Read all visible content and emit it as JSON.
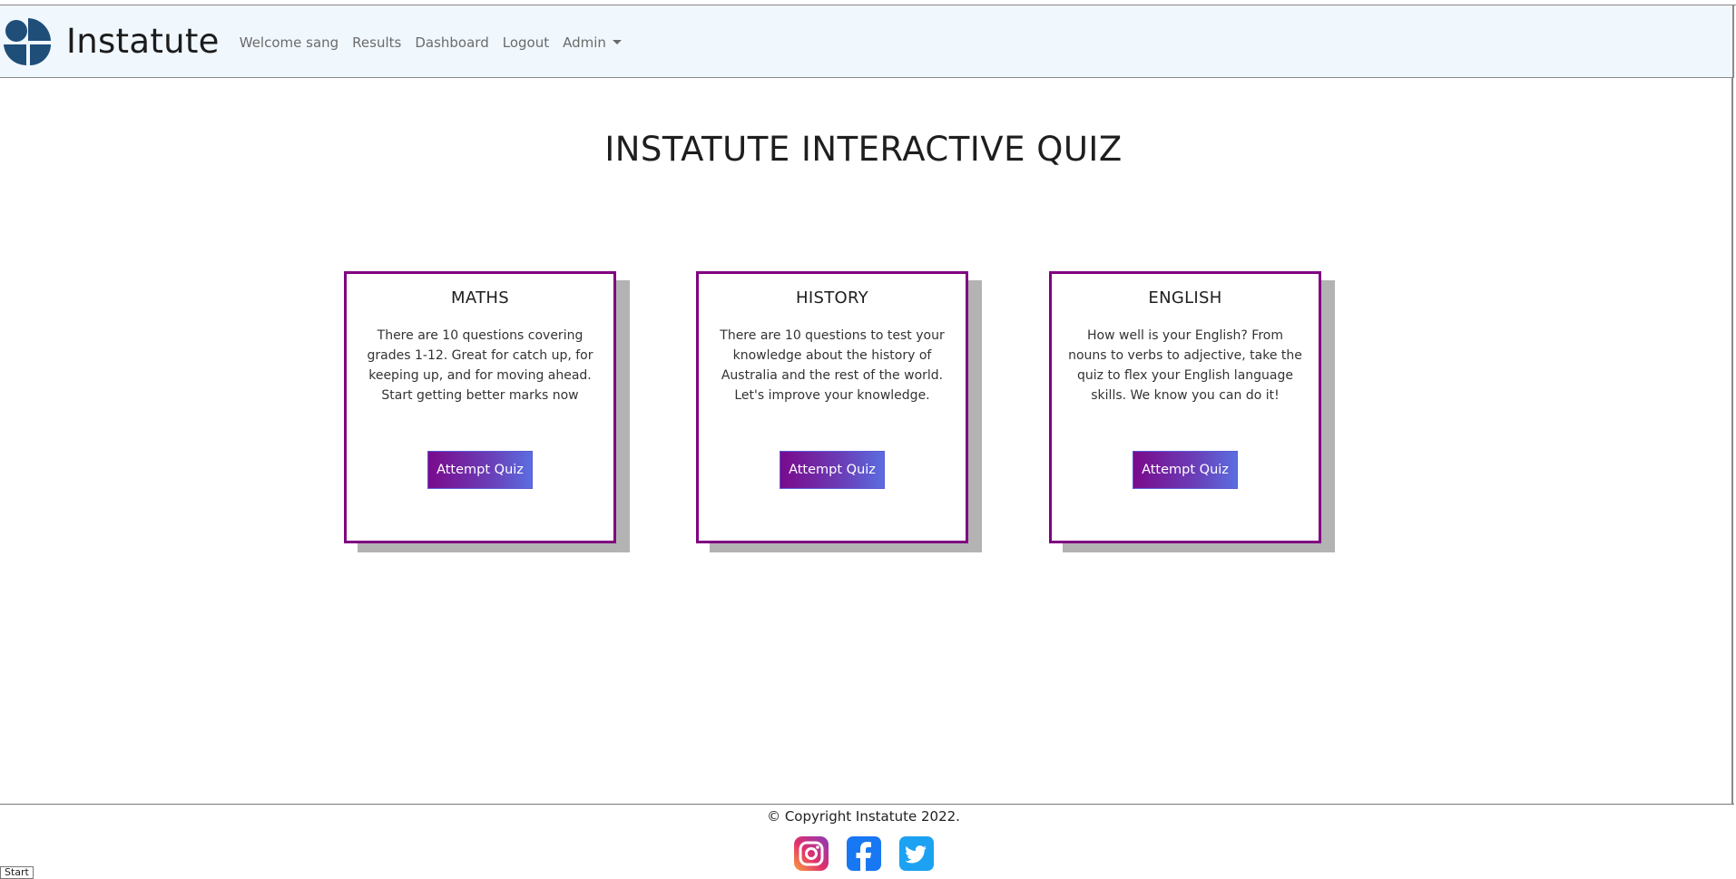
{
  "brand": {
    "name": "Instatute"
  },
  "nav": {
    "welcome": "Welcome sang",
    "results": "Results",
    "dashboard": "Dashboard",
    "logout": "Logout",
    "admin": "Admin"
  },
  "page": {
    "title": "INSTATUTE INTERACTIVE QUIZ"
  },
  "cards": [
    {
      "title": "MATHS",
      "text": "There are 10 questions covering grades 1-12. Great for catch up, for keeping up, and for moving ahead. Start getting better marks now",
      "button": "Attempt Quiz"
    },
    {
      "title": "HISTORY",
      "text": "There are 10 questions to test your knowledge about the history of Australia and the rest of the world. Let's improve your knowledge.",
      "button": "Attempt Quiz"
    },
    {
      "title": "ENGLISH",
      "text": "How well is your English? From nouns to verbs to adjective, take the quiz to flex your English language skills. We know you can do it!",
      "button": "Attempt Quiz"
    }
  ],
  "footer": {
    "copyright": "© Copyright Instatute 2022.",
    "socials": [
      "instagram-icon",
      "facebook-icon",
      "twitter-icon"
    ]
  },
  "taskbar": {
    "start": "Start"
  },
  "colors": {
    "accent": "#800080",
    "navbar_bg": "#f0f7fd",
    "logo": "#1f4e79",
    "button_gradient": [
      "#7a0a8c",
      "#5a6ee0"
    ]
  }
}
